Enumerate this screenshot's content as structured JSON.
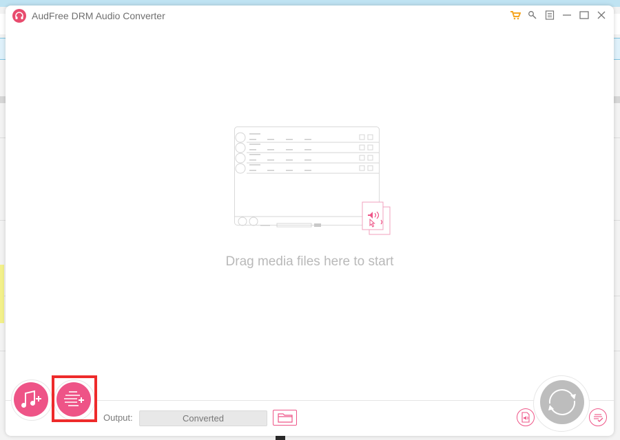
{
  "window": {
    "title": "AudFree DRM Audio Converter"
  },
  "titlebar": {
    "icons": [
      "cart-icon",
      "search-icon",
      "menu-icon",
      "minimize-icon",
      "maximize-icon",
      "close-icon"
    ],
    "cart_color": "#f5a623"
  },
  "main": {
    "drop_hint": "Drag media files here to start"
  },
  "bottom": {
    "add_music_button": "add-music-icon",
    "add_playlist_button": "add-playlist-icon",
    "output_label": "Output:",
    "output_value": "Converted",
    "browse_folder_icon": "folder-icon",
    "format_icon": "audio-format-icon",
    "convert_icon": "convert-icon",
    "history_icon": "converted-history-icon"
  },
  "colors": {
    "accent": "#ee5487",
    "highlight": "#ee2b2b",
    "convert_disabled": "#bdbdbd"
  }
}
